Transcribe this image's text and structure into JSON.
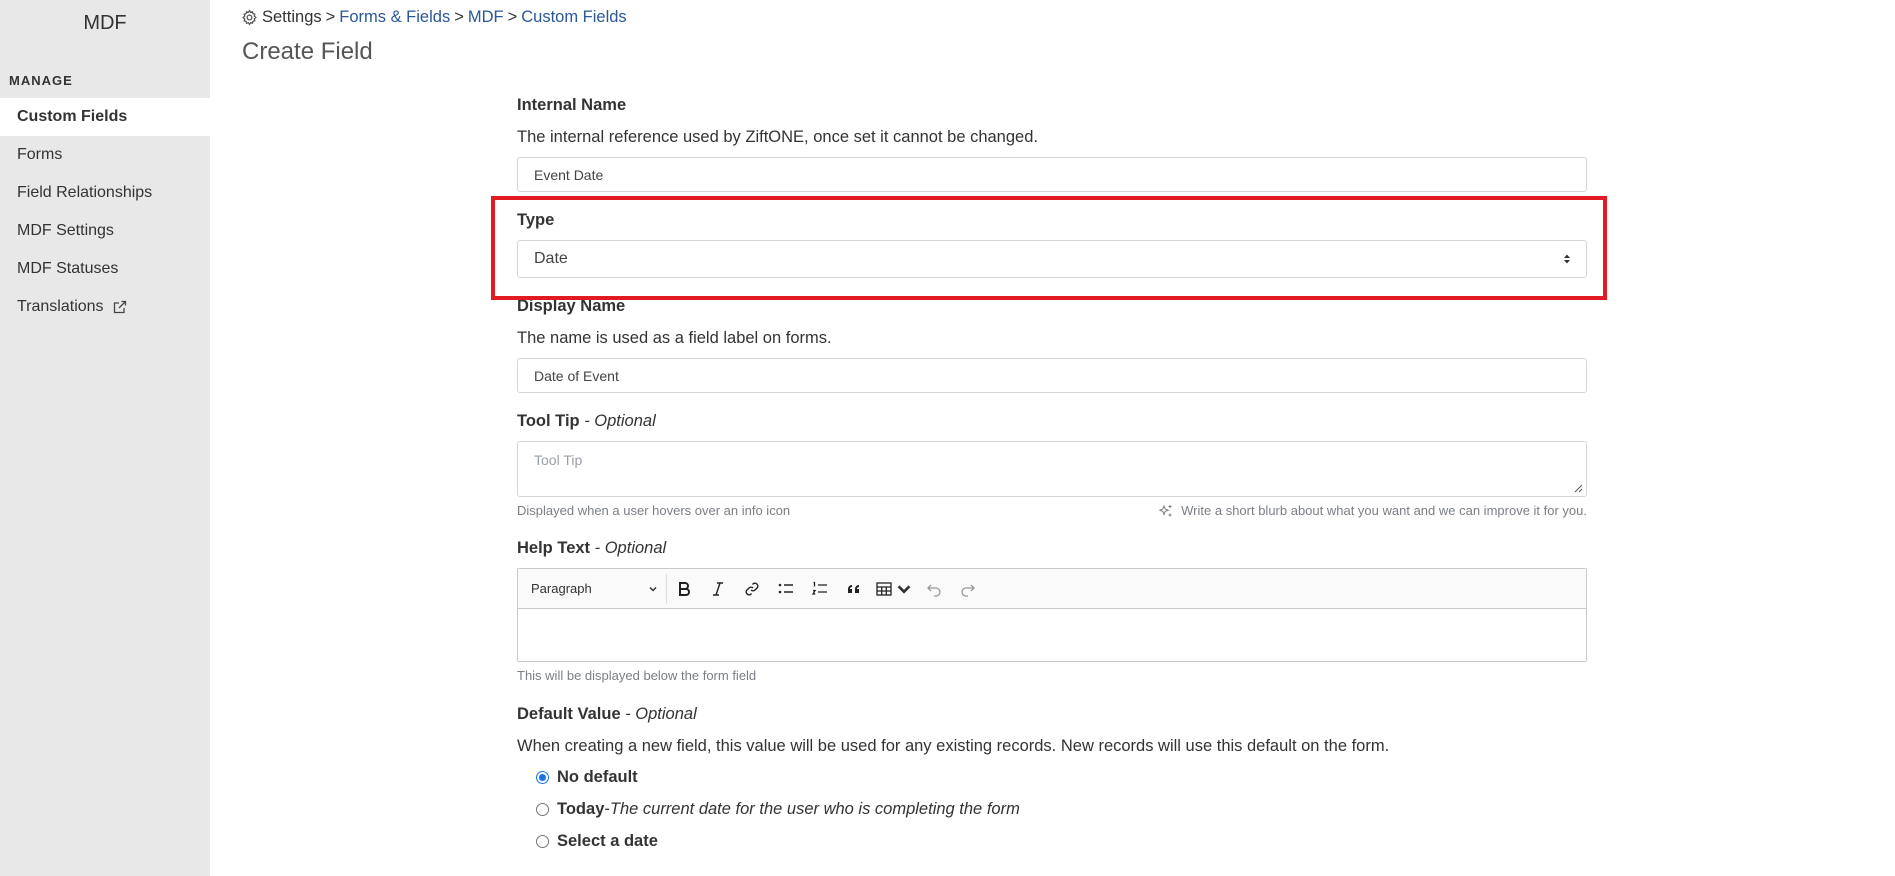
{
  "sidebar": {
    "app_title": "MDF",
    "section_label": "MANAGE",
    "items": [
      {
        "label": "Custom Fields"
      },
      {
        "label": "Forms"
      },
      {
        "label": "Field Relationships"
      },
      {
        "label": "MDF Settings"
      },
      {
        "label": "MDF Statuses"
      },
      {
        "label": "Translations"
      }
    ]
  },
  "breadcrumb": {
    "items": [
      "Settings",
      "Forms & Fields",
      "MDF",
      "Custom Fields"
    ],
    "separator": ">"
  },
  "page_title": "Create Field",
  "form": {
    "internal_name": {
      "label": "Internal Name",
      "description": "The internal reference used by ZiftONE, once set it cannot be changed.",
      "value": "Event Date"
    },
    "type": {
      "label": "Type",
      "value": "Date"
    },
    "display_name": {
      "label": "Display Name",
      "description": "The name is used as a field label on forms.",
      "value": "Date of Event"
    },
    "tool_tip": {
      "label": "Tool Tip",
      "optional": "Optional",
      "placeholder": "Tool Tip",
      "hint": "Displayed when a user hovers over an info icon",
      "ai_hint": "Write a short blurb about what you want and we can improve it for you."
    },
    "help_text": {
      "label": "Help Text",
      "optional": "Optional",
      "paragraph_style": "Paragraph",
      "hint": "This will be displayed below the form field"
    },
    "default_value": {
      "label": "Default Value",
      "optional": "Optional",
      "description": "When creating a new field, this value will be used for any existing records. New records will use this default on the form.",
      "options": [
        {
          "label": "No default",
          "detail": "",
          "checked": true
        },
        {
          "label": "Today",
          "detail": "The current date for the user who is completing the form",
          "checked": false
        },
        {
          "label": "Select a date",
          "detail": "",
          "checked": false
        }
      ]
    },
    "dash": " - "
  },
  "colors": {
    "sidebar_bg": "#e8e8e8",
    "link": "#2b5797",
    "highlight": "#e01b24",
    "radio_accent": "#1a73e8"
  }
}
